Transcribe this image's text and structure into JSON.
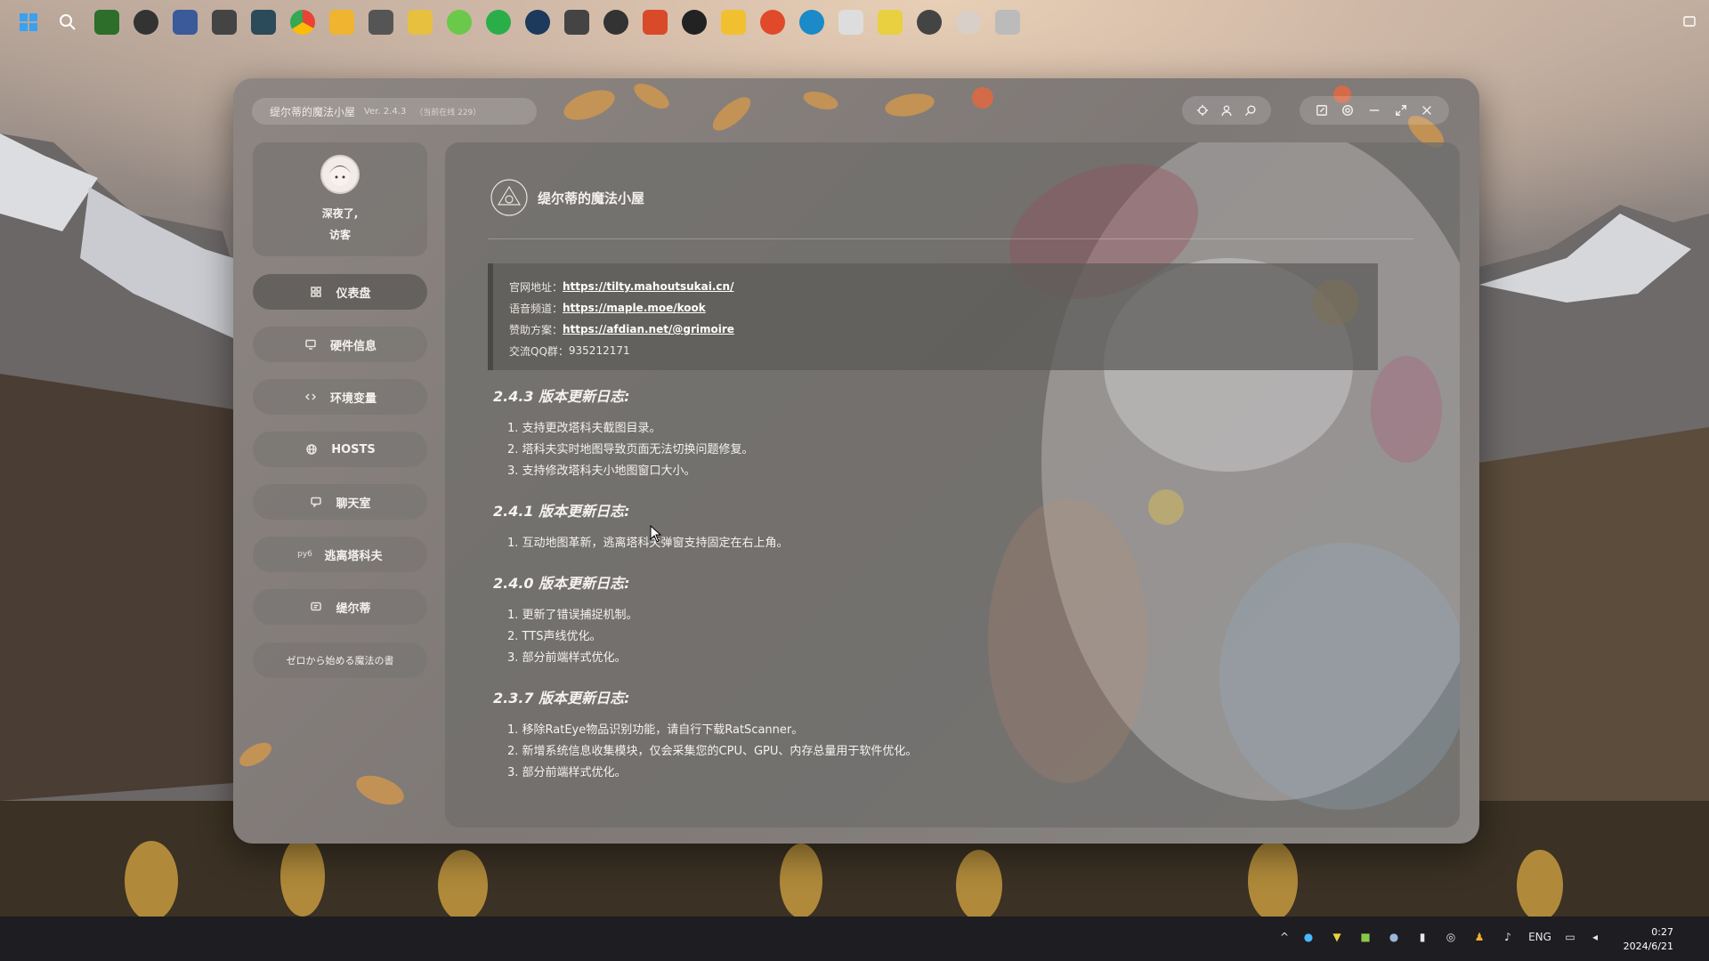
{
  "window": {
    "app_title": "缇尔蒂的魔法小屋",
    "version": "Ver. 2.4.3",
    "online": "（当前在线 229）"
  },
  "user": {
    "greeting_line1": "深夜了,",
    "greeting_line2": "访客"
  },
  "nav": {
    "items": [
      {
        "label": "仪表盘",
        "icon": "grid-icon"
      },
      {
        "label": "硬件信息",
        "icon": "monitor-icon"
      },
      {
        "label": "环境变量",
        "icon": "code-icon"
      },
      {
        "label": "HOSTS",
        "icon": "globe-icon"
      },
      {
        "label": "聊天室",
        "icon": "chat-icon"
      },
      {
        "label": "逃离塔科夫",
        "icon": "py6-icon",
        "icon_text": "py6"
      },
      {
        "label": "缇尔蒂",
        "icon": "message-icon"
      }
    ],
    "footer_button": "ゼロから始める魔法の書"
  },
  "main": {
    "title": "缇尔蒂的魔法小屋",
    "info": {
      "site_label": "官网地址：",
      "site_url": "https://tilty.mahoutsukai.cn/",
      "voice_label": "语音频道：",
      "voice_url": "https://maple.moe/kook",
      "sponsor_label": "赞助方案：",
      "sponsor_url": "https://afdian.net/@grimoire",
      "qq_label": "交流QQ群：",
      "qq_value": "935212171"
    },
    "changelogs": [
      {
        "title": "2.4.3 版本更新日志:",
        "items": [
          "1. 支持更改塔科夫截图目录。",
          "2. 塔科夫实时地图导致页面无法切换问题修复。",
          "3. 支持修改塔科夫小地图窗口大小。"
        ]
      },
      {
        "title": "2.4.1 版本更新日志:",
        "items": [
          "1. 互动地图革新，逃离塔科夫弹窗支持固定在右上角。"
        ]
      },
      {
        "title": "2.4.0 版本更新日志:",
        "items": [
          "1. 更新了错误捕捉机制。",
          "2. TTS声线优化。",
          "3. 部分前端样式优化。"
        ]
      },
      {
        "title": "2.3.7 版本更新日志:",
        "items": [
          "1. 移除RatEye物品识别功能，请自行下载RatScanner。",
          "2. 新增系统信息收集模块，仅会采集您的CPU、GPU、内存总量用于软件优化。",
          "3. 部分前端样式优化。"
        ]
      }
    ]
  },
  "taskbar": {
    "language": "ENG",
    "time": "0:27",
    "date": "2024/6/21"
  }
}
